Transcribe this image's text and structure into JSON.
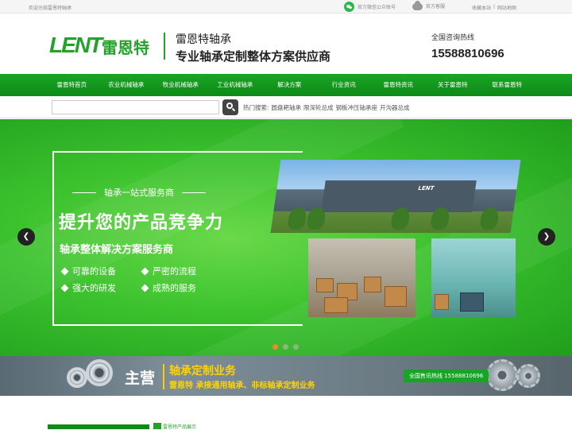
{
  "topbar": {
    "welcome": "欢迎光临雷恩特轴承",
    "wechat": "官方微信公众账号",
    "service": "官方客服",
    "bookmark": "收藏本站",
    "separator": "|",
    "sitemap": "网站地图"
  },
  "header": {
    "logo_mark": "LENT",
    "logo_cn": "雷恩特",
    "brand_name": "雷恩特轴承",
    "slogan": "专业轴承定制整体方案供应商",
    "hotline_label": "全国咨询热线",
    "hotline_number": "15588810696"
  },
  "nav": {
    "items": [
      "雷恩特首页",
      "农业机械轴承",
      "牧业机械轴承",
      "工业机械轴承",
      "解决方案",
      "行业资讯",
      "雷恩特资讯",
      "关于雷恩特",
      "联系雷恩特"
    ]
  },
  "search": {
    "placeholder": "",
    "hot_label": "热门搜索:",
    "hot_words": [
      "圆盘耙轴承",
      "限深轮总成",
      "钢板冲压轴承座",
      "开沟器总成"
    ]
  },
  "banner": {
    "tagline": "轴承一站式服务商",
    "headline": "提升您的产品竞争力",
    "subline": "轴承整体解决方案服务商",
    "features": [
      "可靠的设备",
      "严密的流程",
      "强大的研发",
      "成熟的服务"
    ],
    "factory_logo": "LENT",
    "prev_icon": "chevron-left-icon",
    "next_icon": "chevron-right-icon",
    "slide_count": 3,
    "active_slide": 1
  },
  "business": {
    "main": "主营",
    "title": "轴承定制业务",
    "desc": "雷恩特 承接通用轴承、非标轴承定制业务",
    "hotline": "全国售讯热线 15588810696"
  },
  "bottom": {
    "label": "雷恩特产品展示"
  },
  "colors": {
    "brand_green": "#22a229",
    "nav_green": "#1ba524",
    "accent_yellow": "#ffd200",
    "active_dot": "#f08a24"
  }
}
